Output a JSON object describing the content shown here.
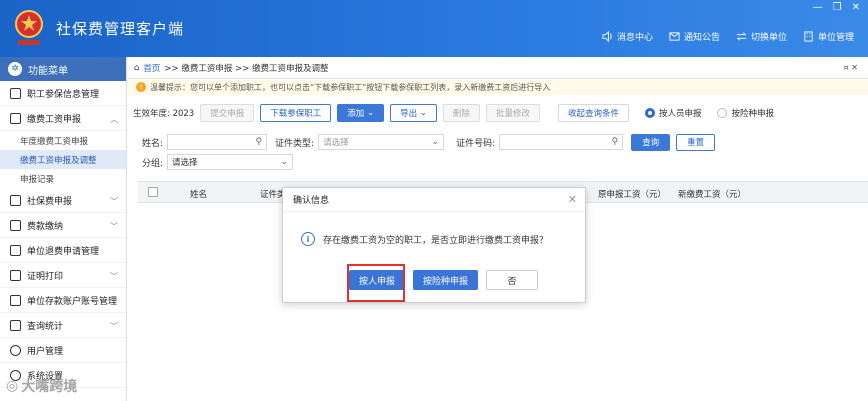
{
  "app": {
    "title": "社保费管理客户端",
    "logo_icon": "emblem-icon"
  },
  "window_controls": {
    "minimize": "—",
    "restore": "❐",
    "close": "✕"
  },
  "top_actions": [
    {
      "label": "消息中心",
      "icon": "speaker-icon"
    },
    {
      "label": "通知公告",
      "icon": "mail-icon"
    },
    {
      "label": "切换单位",
      "icon": "switch-icon"
    },
    {
      "label": "单位管理",
      "icon": "building-icon"
    }
  ],
  "sidebar": {
    "header": "功能菜单",
    "items": [
      {
        "label": "职工参保信息管理"
      },
      {
        "label": "缴费工资申报",
        "expanded": true,
        "children": [
          {
            "label": "年度缴费工资申报"
          },
          {
            "label": "缴费工资申报及调整",
            "active": true
          },
          {
            "label": "申报记录"
          }
        ]
      },
      {
        "label": "社保费申报"
      },
      {
        "label": "费款缴纳"
      },
      {
        "label": "单位退费申请管理"
      },
      {
        "label": "证明打印"
      },
      {
        "label": "单位存款账户账号管理"
      },
      {
        "label": "查询统计"
      },
      {
        "label": "用户管理"
      },
      {
        "label": "系统设置"
      }
    ]
  },
  "breadcrumb": {
    "home": "首页",
    "path": ">> 缴费工资申报 >> 缴费工资申报及调整",
    "close": "✕"
  },
  "tip": "温馨提示：您可以单个添加职工，也可以点击“下载参保职工”按钮下载参保职工列表，录入新缴费工资后进行导入",
  "toolbar": {
    "year_label": "生效年度: 2023",
    "submit": "提交申报",
    "download": "下载参保职工",
    "add": "添加",
    "export": "导出",
    "delete": "删除",
    "batch_edit": "批量修改",
    "collapse": "收起查询条件",
    "radio_person": "按人员申报",
    "radio_type": "按险种申报"
  },
  "filters": {
    "name_label": "姓名:",
    "cert_type_label": "证件类型:",
    "cert_type_placeholder": "请选择",
    "cert_no_label": "证件号码:",
    "group_label": "分组:",
    "group_value": "请选择",
    "query": "查询",
    "reset": "重置"
  },
  "table": {
    "columns": [
      "姓名",
      "证件类",
      "原申报工资（元）",
      "新缴费工资（元）"
    ]
  },
  "dialog": {
    "title": "确认信息",
    "message": "存在缴费工资为空的职工，是否立即进行缴费工资申报？",
    "btn_person": "按人申报",
    "btn_type": "按险种申报",
    "btn_no": "否"
  },
  "watermark": "大嘴跨境",
  "colors": {
    "titlebar": "#1a63c7",
    "primary": "#3a74d6",
    "highlight": "#e0302f"
  }
}
